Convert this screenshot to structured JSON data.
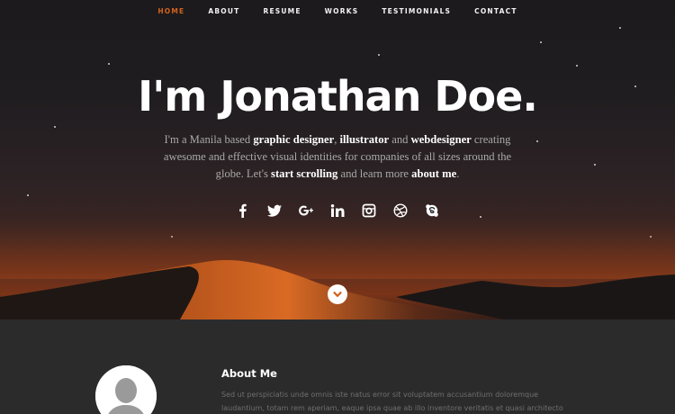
{
  "nav": {
    "items": [
      {
        "label": "HOME",
        "active": true
      },
      {
        "label": "ABOUT",
        "active": false
      },
      {
        "label": "RESUME",
        "active": false
      },
      {
        "label": "WORKS",
        "active": false
      },
      {
        "label": "TESTIMONIALS",
        "active": false
      },
      {
        "label": "CONTACT",
        "active": false
      }
    ],
    "active_color": "#d4621c"
  },
  "hero": {
    "headline": "I'm Jonathan Doe.",
    "intro": {
      "t1": "I'm a Manila based ",
      "b1": "graphic designer",
      "t2": ", ",
      "b2": "illustrator",
      "t3": " and ",
      "b3": "webdesigner",
      "t4": " creating awesome and effective visual identities for companies of all sizes around the globe. Let's ",
      "b4": "start scrolling",
      "t5": " and learn more ",
      "b5": "about me",
      "t6": "."
    },
    "social_icons": [
      "facebook-icon",
      "twitter-icon",
      "google-plus-icon",
      "linkedin-icon",
      "instagram-icon",
      "dribbble-icon",
      "skype-icon"
    ],
    "scroll_icon": "chevron-down-icon"
  },
  "about": {
    "title": "About Me",
    "text": "Sed ut perspiciatis unde omnis iste natus error sit voluptatem accusantium doloremque laudantium, totam rem aperiam, eaque ipsa quae ab illo inventore veritatis et quasi architecto"
  }
}
